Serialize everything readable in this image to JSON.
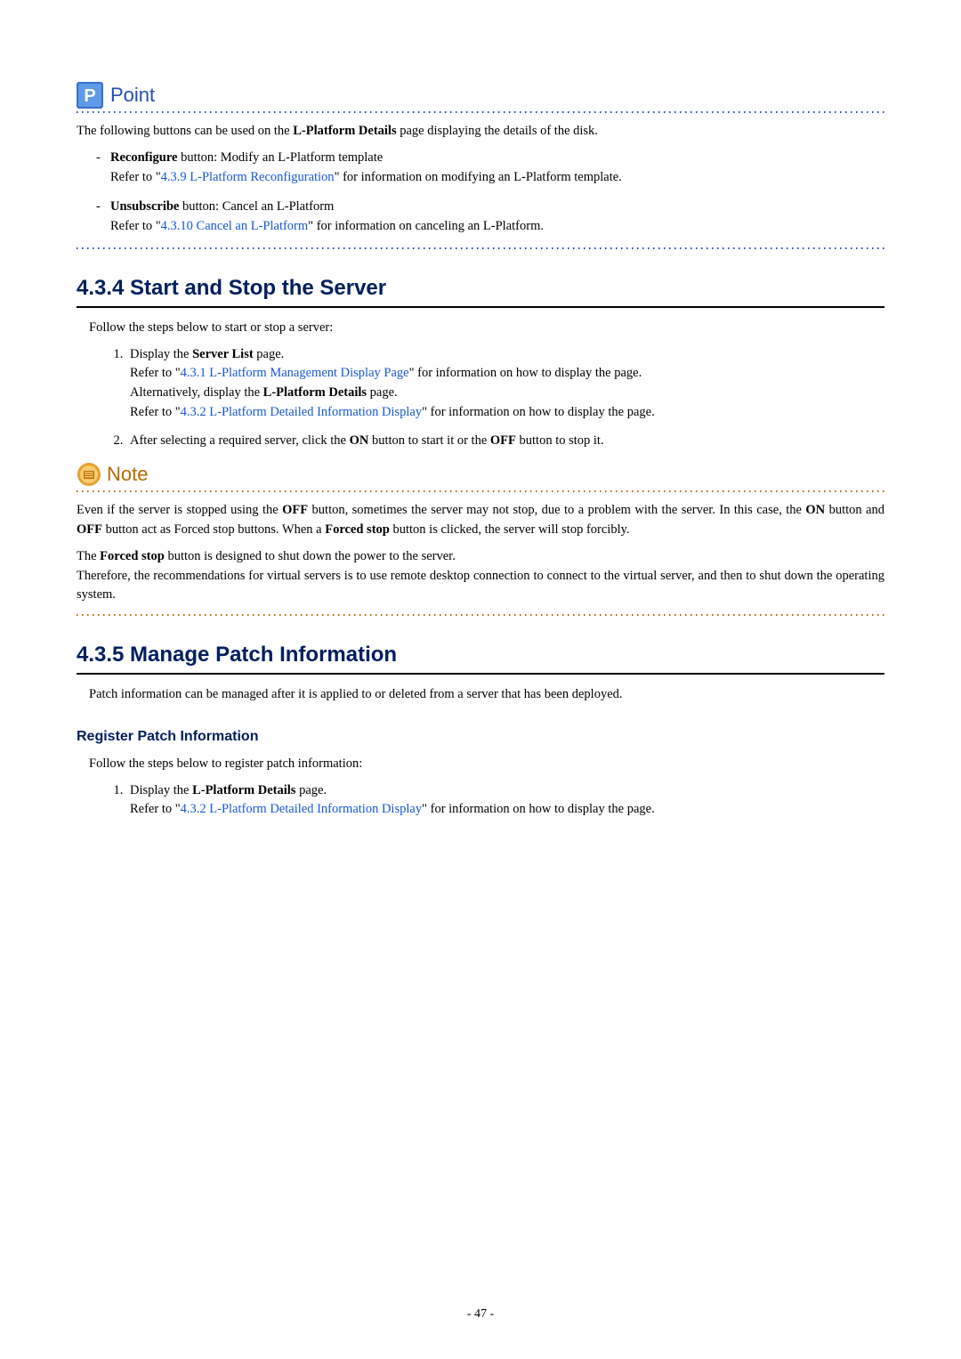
{
  "point": {
    "label": "Point",
    "intro": "The following buttons can be used on the ",
    "intro_bold": "L-Platform Details",
    "intro_after": " page displaying the details of the disk.",
    "items": [
      {
        "bold": "Reconfigure",
        "after_bold": " button: Modify an L-Platform template",
        "refer": "Refer to \"",
        "link": "4.3.9 L-Platform Reconfiguration",
        "refer_after": "\" for information on modifying an L-Platform template."
      },
      {
        "bold": "Unsubscribe",
        "after_bold": " button: Cancel an L-Platform",
        "refer": "Refer to \"",
        "link": "4.3.10 Cancel an L-Platform",
        "refer_after": "\" for information on canceling an L-Platform."
      }
    ]
  },
  "section434": {
    "heading": "4.3.4  Start and Stop the Server",
    "intro": "Follow the steps below to start or stop a server:",
    "step1": {
      "line1_pre": "Display the ",
      "line1_bold": "Server List",
      "line1_post": " page.",
      "line2_pre": "Refer to \"",
      "line2_link": "4.3.1 L-Platform Management Display Page",
      "line2_post": "\" for information on how to display the page.",
      "line3_pre": "Alternatively, display the ",
      "line3_bold": "L-Platform Details",
      "line3_post": " page.",
      "line4_pre": "Refer to \"",
      "line4_link": "4.3.2 L-Platform Detailed Information Display",
      "line4_post": "\" for information on how to display the page."
    },
    "step2": {
      "pre": "After selecting a required server, click the ",
      "b1": "ON",
      "mid": " button to start it or the ",
      "b2": "OFF",
      "post": " button to stop it."
    }
  },
  "note": {
    "label": "Note",
    "p1": {
      "pre": "Even if the server is stopped using the ",
      "b1": "OFF",
      "mid1": " button, sometimes the server may not stop, due to a problem with the server. In this case, the ",
      "b2": "ON",
      "mid2": " button and ",
      "b3": "OFF",
      "mid3": " button act as Forced stop buttons. When a ",
      "b4": "Forced stop",
      "post": " button is clicked, the server will stop forcibly."
    },
    "p2": {
      "pre": "The ",
      "b1": "Forced stop",
      "mid": " button is designed to shut down the power to the server.",
      "line2": "Therefore, the recommendations for virtual servers is to use remote desktop connection to connect to the virtual server, and then to shut down the operating system."
    }
  },
  "section435": {
    "heading": "4.3.5  Manage Patch Information",
    "intro": "Patch information can be managed after it is applied to or deleted from a server that has been deployed.",
    "sub": "Register Patch Information",
    "sub_intro": "Follow the steps below to register patch information:",
    "step1": {
      "line1_pre": "Display the ",
      "line1_bold": "L-Platform Details",
      "line1_post": " page.",
      "line2_pre": "Refer to \"",
      "line2_link": "4.3.2 L-Platform Detailed Information Display",
      "line2_post": "\" for information on how to display the page."
    }
  },
  "page_number": "- 47 -"
}
